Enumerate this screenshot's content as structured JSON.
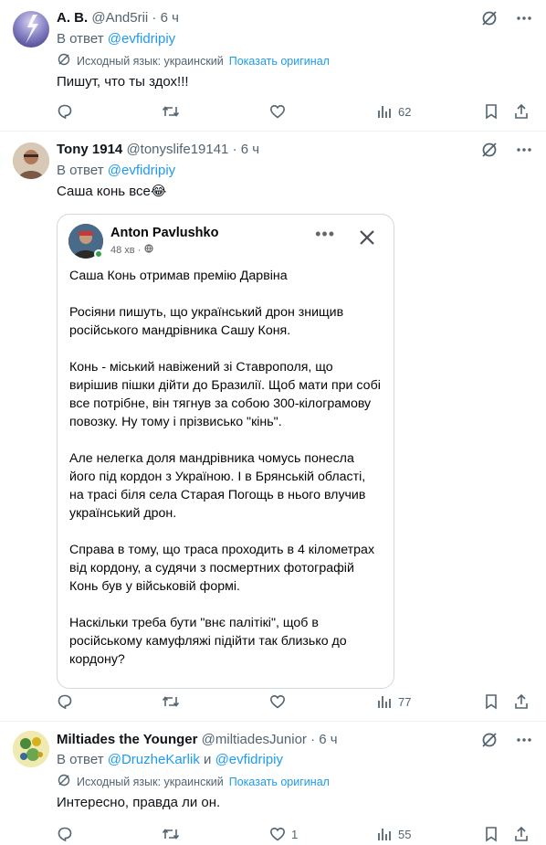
{
  "tweets": [
    {
      "name": "А. В.",
      "handle": "@And5rii · 6 ч",
      "reply_prefix": "В ответ",
      "reply_to": "@evfidripiy",
      "reply_and": "",
      "reply_to2": "",
      "translation_note": "Исходный язык: украинский",
      "show_original": "Показать оригинал",
      "text": "Пишут, что ты здох!!!",
      "stats": {
        "replies": "",
        "retweets": "",
        "likes": "",
        "views": "62"
      }
    },
    {
      "name": "Tony 1914",
      "handle": "@tonyslife19141 · 6 ч",
      "reply_prefix": "В ответ",
      "reply_to": "@evfidripiy",
      "text": "Саша конь все😂",
      "stats": {
        "replies": "",
        "retweets": "",
        "likes": "",
        "views": "77"
      },
      "embed": {
        "author": "Anton Pavlushko",
        "time": "48 хв ·",
        "menu_glyph": "•••",
        "paragraphs": [
          "Саша Конь отримав премію Дарвіна",
          "Росіяни пишуть, що український дрон знищив російського мандрівника Сашу Коня.",
          "Конь - міський навіжений зі Ставрополя, що вирішив пішки дійти до Бразилії. Щоб мати при собі все потрібне, він тягнув за собою 300-кілограмову повозку. Ну тому і прізвисько \"кінь\".",
          "Але нелегка доля мандрівника чомусь понесла його під кордон з Україною. І в Брянській області, на трасі біля села Старая Погощь в нього влучив український дрон.",
          "Справа в тому, що траса проходить в 4 кілометрах від кордону, а судячи з посмертних фотографій Конь був у військовій формі.",
          "Наскільки треба бути \"внє палітікі\", щоб в російському камуфляжі підійти так близько до кордону?"
        ]
      }
    },
    {
      "name": "Miltiades the Younger",
      "handle": "@miltiadesJunior · 6 ч",
      "reply_prefix": "В ответ",
      "reply_to": "@DruzheKarlik",
      "reply_and": "и",
      "reply_to2": "@evfidripiy",
      "translation_note": "Исходный язык: украинский",
      "show_original": "Показать оригинал",
      "text": "Интересно, правда ли он.",
      "stats": {
        "replies": "",
        "retweets": "",
        "likes": "1",
        "views": "55"
      }
    }
  ],
  "colors": {
    "accent": "#1d9bf0",
    "secondary_text": "#536471",
    "divider": "#eff3f4"
  }
}
